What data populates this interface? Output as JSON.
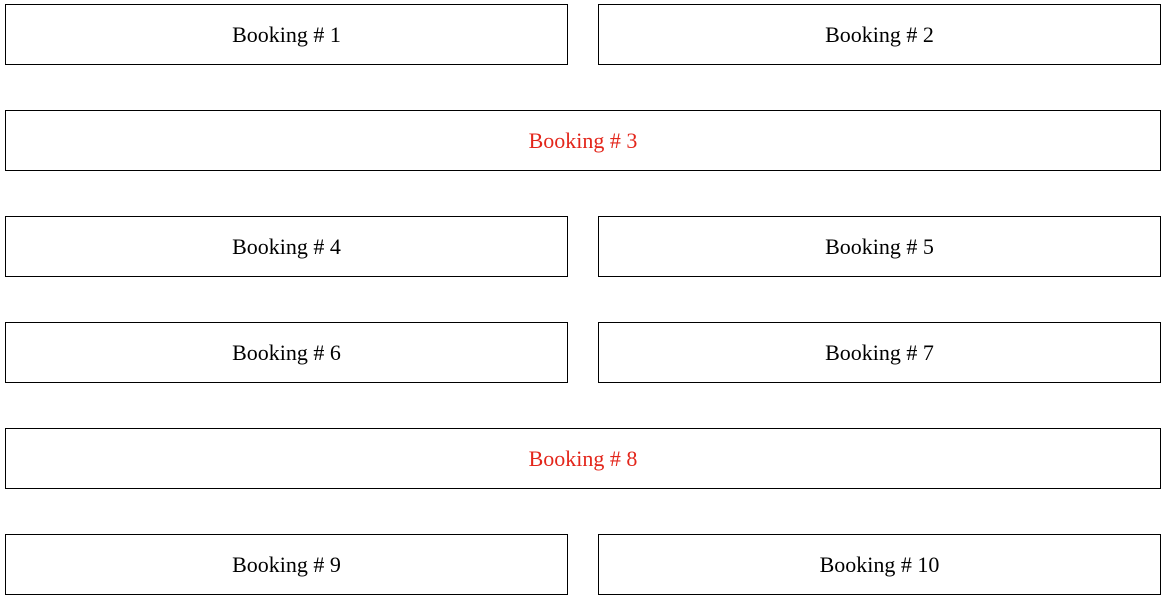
{
  "bookings": [
    {
      "label": "Booking # 1"
    },
    {
      "label": "Booking # 2"
    },
    {
      "label": "Booking # 3"
    },
    {
      "label": "Booking # 4"
    },
    {
      "label": "Booking # 5"
    },
    {
      "label": "Booking # 6"
    },
    {
      "label": "Booking # 7"
    },
    {
      "label": "Booking # 8"
    },
    {
      "label": "Booking # 9"
    },
    {
      "label": "Booking # 10"
    }
  ],
  "colors": {
    "border": "#000000",
    "text": "#000000",
    "highlight_text": "#e3261b",
    "background": "#ffffff"
  }
}
